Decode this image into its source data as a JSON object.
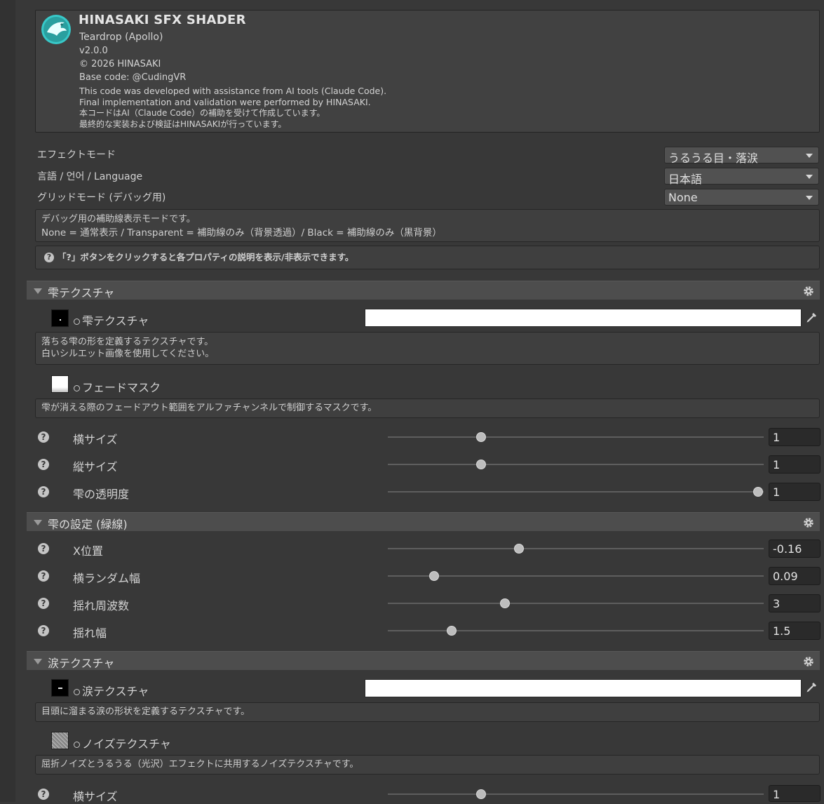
{
  "header": {
    "title": "HINASAKI SFX SHADER",
    "subtitle": "Teardrop (Apollo)",
    "version": "v2.0.0",
    "copyright": "© 2026 HINASAKI",
    "base_code": "Base code: @CudingVR",
    "note_en_1": "This code was developed with assistance from AI tools (Claude Code).",
    "note_en_2": "Final implementation and validation were performed by HINASAKI.",
    "note_ja_1": "本コードはAI（Claude Code）の補助を受けて作成しています。",
    "note_ja_2": "最終的な実装および検証はHINASAKIが行っています。",
    "logo_icon": "hinasaki-bird-logo",
    "accent_color": "#38c8c8"
  },
  "settings": {
    "effect_mode": {
      "label": "エフェクトモード",
      "value": "うるうる目・落涙"
    },
    "language": {
      "label": "言語 / 언어 / Language",
      "value": "日本語"
    },
    "grid_mode": {
      "label": "グリッドモード (デバッグ用)",
      "value": "None"
    },
    "grid_info_1": "デバッグ用の補助線表示モードです。",
    "grid_info_2": "None = 通常表示 / Transparent = 補助線のみ（背景透過）/ Black = 補助線のみ（黒背景）",
    "help_tip": "「?」ボタンをクリックすると各プロパティの説明を表示/非表示できます。"
  },
  "sections": {
    "drop_texture": {
      "title": "雫テクスチャ",
      "texture_label": "雫テクスチャ",
      "texture_info_1": "落ちる雫の形を定義するテクスチャです。",
      "texture_info_2": "白いシルエット画像を使用してください。",
      "fade_label": "フェードマスク",
      "fade_info": "雫が消える際のフェードアウト範囲をアルファチャンネルで制御するマスクです。",
      "sliders": [
        {
          "label": "横サイズ",
          "value": "1",
          "fraction": 0.24
        },
        {
          "label": "縦サイズ",
          "value": "1",
          "fraction": 0.24
        },
        {
          "label": "雫の透明度",
          "value": "1",
          "fraction": 1.0
        }
      ]
    },
    "drop_settings": {
      "title": "雫の設定 (緑線)",
      "sliders": [
        {
          "label": "X位置",
          "value": "-0.16",
          "fraction": 0.345
        },
        {
          "label": "横ランダム幅",
          "value": "0.09",
          "fraction": 0.112
        },
        {
          "label": "揺れ周波数",
          "value": "3",
          "fraction": 0.305
        },
        {
          "label": "揺れ幅",
          "value": "1.5",
          "fraction": 0.16
        }
      ]
    },
    "tear_texture": {
      "title": "涙テクスチャ",
      "texture_label": "涙テクスチャ",
      "texture_info": "目頭に溜まる涙の形状を定義するテクスチャです。",
      "noise_label": "ノイズテクスチャ",
      "noise_info": "屈折ノイズとうるうる（光沢）エフェクトに共用するノイズテクスチャです。",
      "sliders": [
        {
          "label": "横サイズ",
          "value": "1",
          "fraction": 0.24
        }
      ]
    }
  },
  "icons": {
    "help": "?",
    "gear": "gear-icon",
    "picker": "eyedropper-icon",
    "foldout": "triangle-down-icon"
  }
}
